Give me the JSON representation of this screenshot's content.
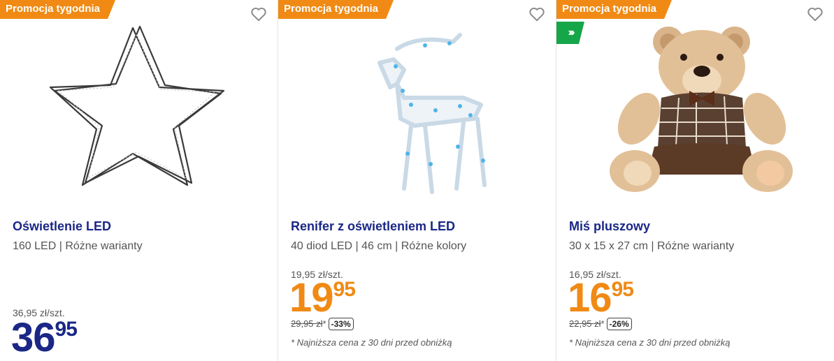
{
  "products": [
    {
      "promo": "Promocja tygodnia",
      "title": "Oświetlenie LED",
      "subtitle": "160 LED | Różne warianty",
      "unit_price": "36,95 zł/szt.",
      "price_int": "36",
      "price_dec": "95",
      "price_color": "#1a2787"
    },
    {
      "promo": "Promocja tygodnia",
      "title": "Renifer z oświetleniem LED",
      "subtitle": "40 diod LED | 46 cm | Różne kolory",
      "unit_price": "19,95 zł/szt.",
      "price_int": "19",
      "price_dec": "95",
      "price_color": "#f08a14",
      "old_price": "29,95 zł",
      "asterisk": "*",
      "discount": "-33%",
      "note": "* Najniższa cena z 30 dni przed obniżką"
    },
    {
      "promo": "Promocja tygodnia",
      "badge_icon": "double-chevron-right-icon",
      "title": "Miś pluszowy",
      "subtitle": "30 x 15 x 27 cm | Różne warianty",
      "unit_price": "16,95 zł/szt.",
      "price_int": "16",
      "price_dec": "95",
      "price_color": "#f08a14",
      "old_price": "22,95 zł",
      "asterisk": "*",
      "discount": "-26%",
      "note": "* Najniższa cena z 30 dni przed obniżką"
    }
  ],
  "colors": {
    "promo_bg": "#f08a14",
    "title": "#1a2787",
    "badge_green": "#16a64a"
  }
}
